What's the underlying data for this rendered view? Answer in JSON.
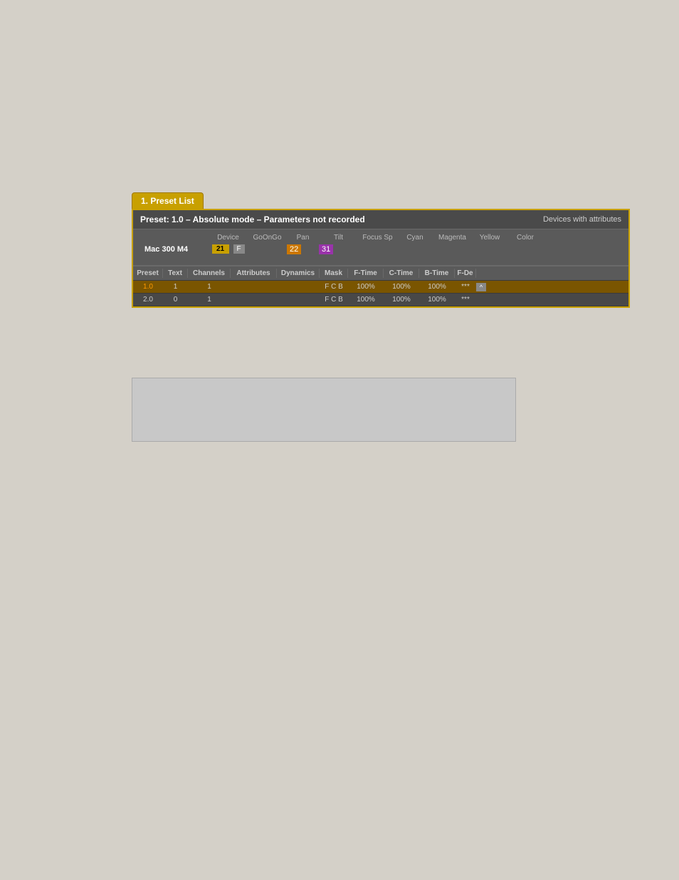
{
  "tab": {
    "label": "1. Preset List"
  },
  "panel": {
    "header": {
      "title": "Preset: 1.0 – Absolute mode – Parameters not recorded",
      "right": "Devices with attributes"
    },
    "device": {
      "name": "Mac 300 M4",
      "badge_number": "21",
      "badge_f": "F",
      "columns": [
        "Device",
        "GoOnGo",
        "Pan",
        "Tilt",
        "Focus Sp",
        "Cyan",
        "Magenta",
        "Yellow",
        "Color"
      ],
      "pan_value": "22",
      "tilt_value": "31"
    },
    "preset_table": {
      "headers": [
        "Preset",
        "Text",
        "Channels",
        "Attributes",
        "Dynamics",
        "Mask",
        "F-Time",
        "C-Time",
        "B-Time",
        "F-De"
      ],
      "rows": [
        {
          "preset": "1.0",
          "text": "1",
          "channels": "1",
          "attributes": "",
          "dynamics": "",
          "mask": "F C B",
          "ftime": "100%",
          "ctime": "100%",
          "btime": "100%",
          "fde": "***",
          "selected": true
        },
        {
          "preset": "2.0",
          "text": "0",
          "channels": "1",
          "attributes": "",
          "dynamics": "",
          "mask": "F C B",
          "ftime": "100%",
          "ctime": "100%",
          "btime": "100%",
          "fde": "***",
          "selected": false
        }
      ]
    }
  },
  "colors": {
    "tab_bg": "#c8a000",
    "panel_border": "#c8a000",
    "panel_bg": "#5a5a5a",
    "header_bg": "#4a4a4a",
    "selected_row": "#7a5500",
    "pan_cell_bg": "#cc7700",
    "tilt_cell_bg": "#9933aa"
  }
}
